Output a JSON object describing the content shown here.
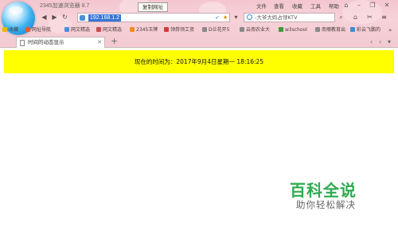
{
  "browser": {
    "app_title": "2345加速浏览器 8.7",
    "tooltip": "复制网址",
    "menu": [
      "文件",
      "查看",
      "收藏",
      "工具",
      "帮助"
    ],
    "address": {
      "value": "192.168.1.2"
    },
    "search": {
      "text": "-大爷大妈占领KTV"
    },
    "favorites": [
      "收藏",
      "网址导航",
      "网文精选",
      "2345王牌",
      "领券领工资",
      "D兰花开5",
      "云南农业大",
      "w3school",
      "南哪教育出",
      "彩云飞鹏的"
    ],
    "tab": {
      "title": "时间的动态显示"
    },
    "new_tab_label": "+"
  },
  "page": {
    "banner_text": "现在的时间为：2017年9月4日星期一 18:16:25"
  },
  "watermark": {
    "title": "百科全说",
    "subtitle": "助你轻松解决"
  },
  "colors": {
    "banner": "#ffff00",
    "chrome": "#f4c6cf",
    "address_selection": "#3875d7",
    "watermark_green": "#2cab4f"
  }
}
